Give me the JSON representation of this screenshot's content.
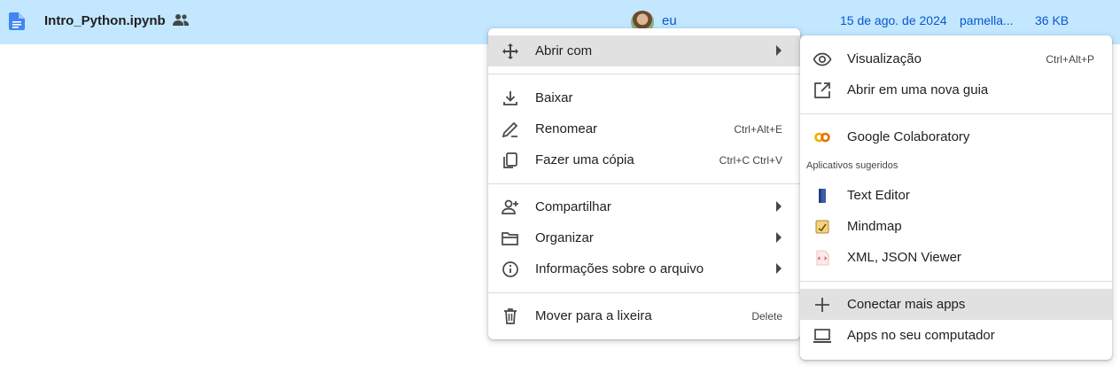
{
  "file_row": {
    "name": "Intro_Python.ipynb",
    "owner": "eu",
    "modified_date": "15 de ago. de 2024",
    "modified_by": "pamella...",
    "size": "36 KB"
  },
  "context_menu": {
    "items": [
      {
        "label": "Abrir com",
        "shortcut": ""
      },
      {
        "label": "Baixar",
        "shortcut": ""
      },
      {
        "label": "Renomear",
        "shortcut": "Ctrl+Alt+E"
      },
      {
        "label": "Fazer uma cópia",
        "shortcut": "Ctrl+C Ctrl+V"
      },
      {
        "label": "Compartilhar",
        "shortcut": ""
      },
      {
        "label": "Organizar",
        "shortcut": ""
      },
      {
        "label": "Informações sobre o arquivo",
        "shortcut": ""
      },
      {
        "label": "Mover para a lixeira",
        "shortcut": "Delete"
      }
    ]
  },
  "open_with_menu": {
    "items": [
      {
        "label": "Visualização",
        "shortcut": "Ctrl+Alt+P"
      },
      {
        "label": "Abrir em uma nova guia",
        "shortcut": ""
      },
      {
        "label": "Google Colaboratory",
        "shortcut": ""
      },
      {
        "label": "Text Editor",
        "shortcut": ""
      },
      {
        "label": "Mindmap",
        "shortcut": ""
      },
      {
        "label": "XML, JSON Viewer",
        "shortcut": ""
      },
      {
        "label": "Conectar mais apps",
        "shortcut": ""
      },
      {
        "label": "Apps no seu computador",
        "shortcut": ""
      }
    ],
    "suggested_header": "Aplicativos sugeridos"
  },
  "colors": {
    "row_selected": "#c2e7ff",
    "link_blue": "#0b57d0",
    "doc_icon_blue": "#4285f4",
    "colab_orange": "#f9ab00",
    "hover_gray": "#e1e1e1"
  }
}
